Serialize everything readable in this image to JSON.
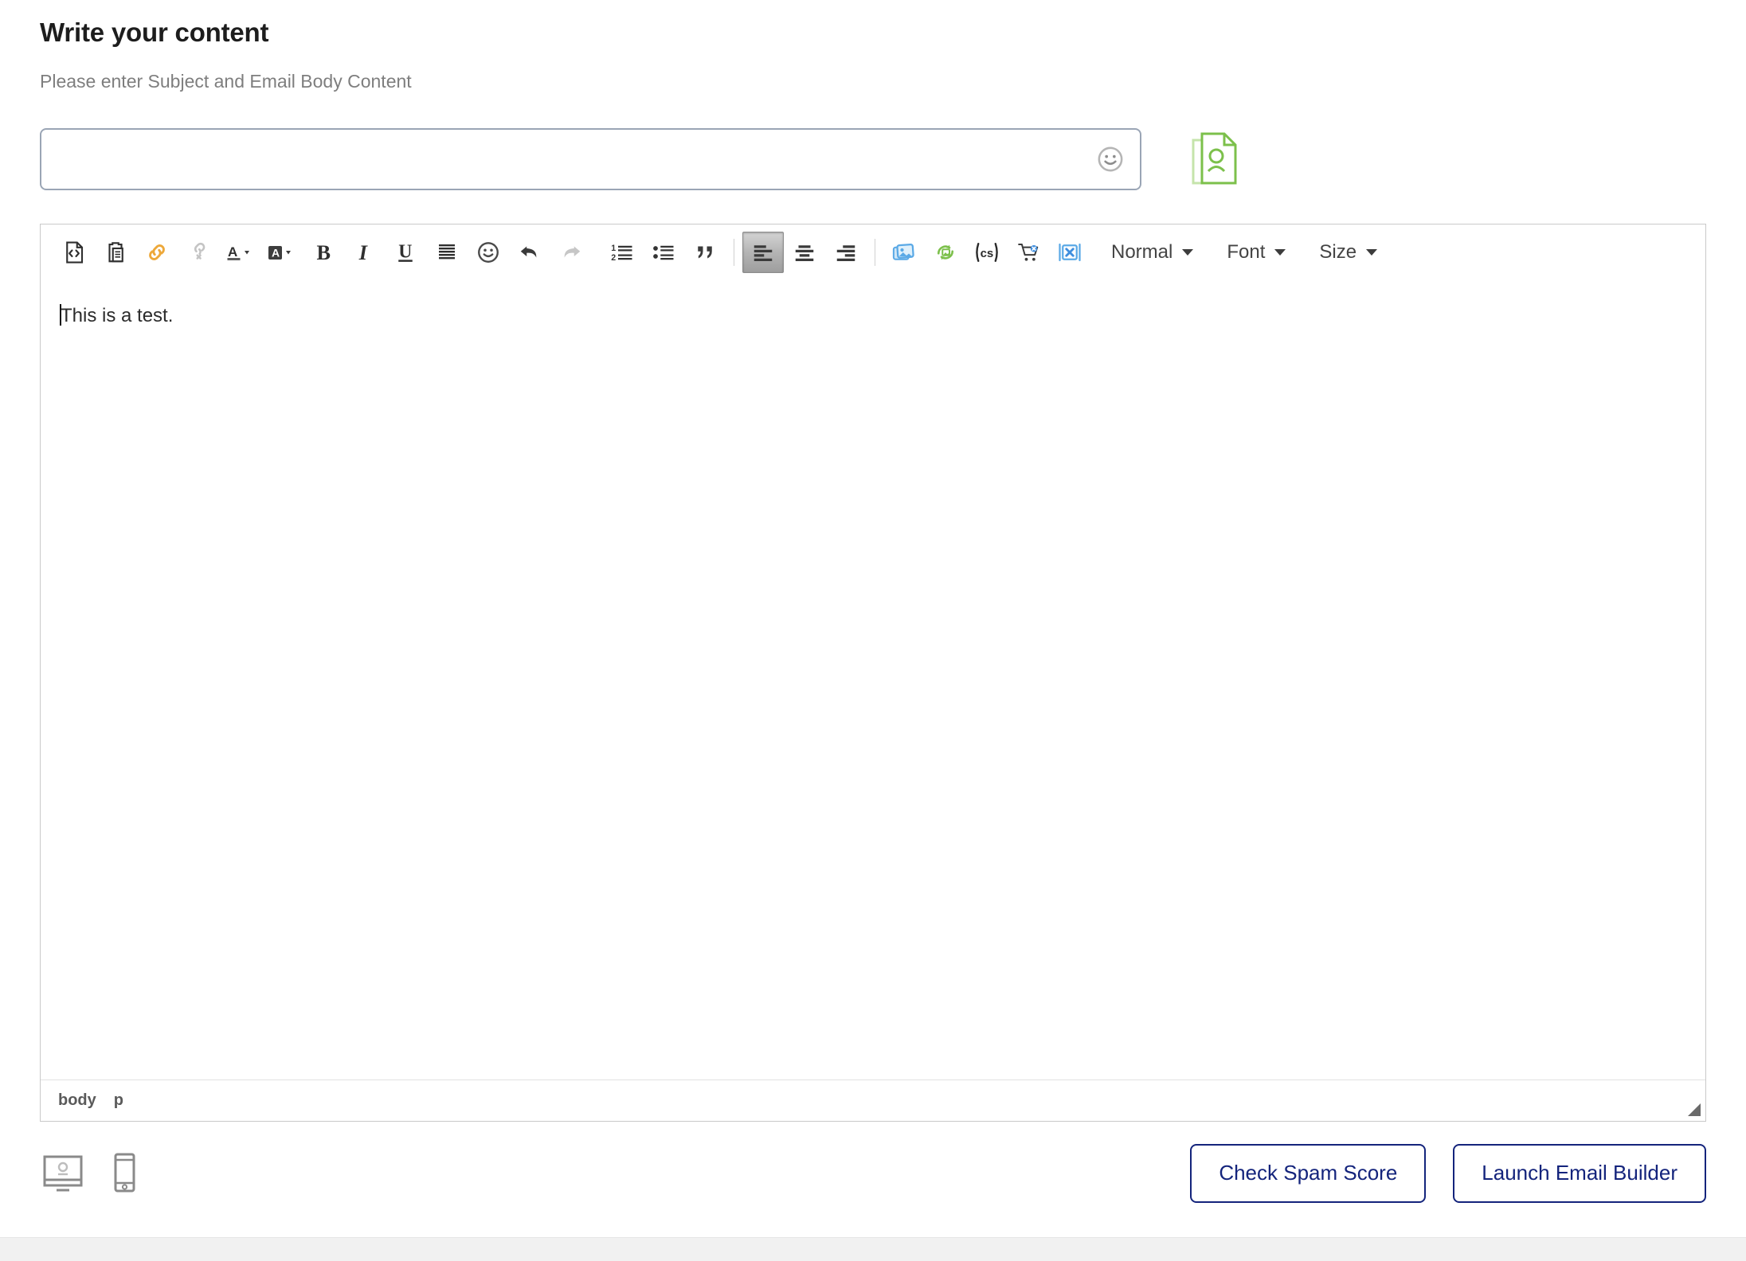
{
  "header": {
    "title": "Write your content",
    "subtitle": "Please enter Subject and Email Body Content"
  },
  "subject": {
    "value": "",
    "placeholder": "",
    "emoji_icon": "smiley-face-icon",
    "contact_icon": "contact-document-icon"
  },
  "toolbar": {
    "items": [
      {
        "name": "source-code-icon",
        "title": "Source Code"
      },
      {
        "name": "paste-icon",
        "title": "Paste"
      },
      {
        "name": "link-icon",
        "title": "Insert Link"
      },
      {
        "name": "unlink-icon",
        "title": "Remove Link"
      },
      {
        "name": "text-color-icon",
        "title": "Text Color"
      },
      {
        "name": "background-color-icon",
        "title": "Background Color"
      },
      {
        "name": "bold-icon",
        "title": "Bold"
      },
      {
        "name": "italic-icon",
        "title": "Italic"
      },
      {
        "name": "underline-icon",
        "title": "Underline"
      },
      {
        "name": "clear-formatting-icon",
        "title": "Clear Formatting"
      },
      {
        "name": "emoji-icon",
        "title": "Emoji"
      },
      {
        "name": "undo-icon",
        "title": "Undo"
      },
      {
        "name": "redo-icon",
        "title": "Redo"
      },
      {
        "name": "ordered-list-icon",
        "title": "Numbered List"
      },
      {
        "name": "bullet-list-icon",
        "title": "Bulleted List"
      },
      {
        "name": "blockquote-icon",
        "title": "Blockquote"
      },
      {
        "name": "align-left-icon",
        "title": "Align Left"
      },
      {
        "name": "align-center-icon",
        "title": "Align Center"
      },
      {
        "name": "align-right-icon",
        "title": "Align Right"
      },
      {
        "name": "image-gallery-icon",
        "title": "Image Gallery"
      },
      {
        "name": "rotate-image-icon",
        "title": "Replace Image"
      },
      {
        "name": "custom-script-icon",
        "title": "Custom Script"
      },
      {
        "name": "cart-icon",
        "title": "Product Cart"
      },
      {
        "name": "remove-block-icon",
        "title": "Remove Block"
      }
    ],
    "dropdowns": [
      {
        "label": "Normal",
        "name": "paragraph-format-dropdown"
      },
      {
        "label": "Font",
        "name": "font-family-dropdown"
      },
      {
        "label": "Size",
        "name": "font-size-dropdown"
      }
    ]
  },
  "editor": {
    "body_text": "This is a test.",
    "status_path": [
      "body",
      "p"
    ]
  },
  "footer": {
    "devices": [
      {
        "name": "desktop-preview-icon",
        "label": "Desktop"
      },
      {
        "name": "mobile-preview-icon",
        "label": "Mobile"
      }
    ],
    "buttons": [
      {
        "label": "Check Spam Score",
        "name": "check-spam-score-button"
      },
      {
        "label": "Launch Email Builder",
        "name": "launch-email-builder-button"
      }
    ]
  },
  "colors": {
    "accent_navy": "#14247c",
    "link_orange": "#eda83a",
    "green": "#7cc04b",
    "blue": "#5aa9e6",
    "input_border": "#9aa5b5"
  }
}
